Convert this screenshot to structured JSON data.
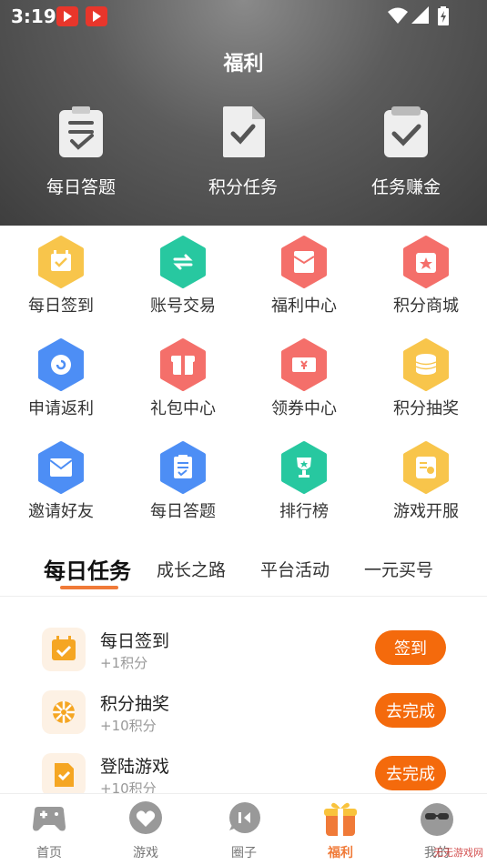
{
  "status_bar": {
    "time": "3:19"
  },
  "header": {
    "title": "福利",
    "items": [
      {
        "label": "每日答题",
        "icon": "quiz-clipboard-icon"
      },
      {
        "label": "积分任务",
        "icon": "points-task-doc-icon"
      },
      {
        "label": "任务赚金",
        "icon": "task-earn-clipboard-icon"
      }
    ]
  },
  "grid": [
    {
      "label": "每日签到",
      "icon": "calendar-checkin-icon",
      "color": "#f8c54b"
    },
    {
      "label": "账号交易",
      "icon": "exchange-icon",
      "color": "#27c8a0"
    },
    {
      "label": "福利中心",
      "icon": "envelope-icon",
      "color": "#f46f6a"
    },
    {
      "label": "积分商城",
      "icon": "store-bag-icon",
      "color": "#f46f6a"
    },
    {
      "label": "申请返利",
      "icon": "rebate-icon",
      "color": "#4d8ef5"
    },
    {
      "label": "礼包中心",
      "icon": "gift-icon",
      "color": "#f46f6a"
    },
    {
      "label": "领券中心",
      "icon": "coupon-icon",
      "color": "#f46f6a"
    },
    {
      "label": "积分抽奖",
      "icon": "coins-icon",
      "color": "#f8c54b"
    },
    {
      "label": "邀请好友",
      "icon": "invite-mail-icon",
      "color": "#4d8ef5"
    },
    {
      "label": "每日答题",
      "icon": "quiz-clipboard-icon",
      "color": "#4d8ef5"
    },
    {
      "label": "排行榜",
      "icon": "trophy-icon",
      "color": "#27c8a0"
    },
    {
      "label": "游戏开服",
      "icon": "server-open-icon",
      "color": "#f8c54b"
    }
  ],
  "tabs": [
    {
      "label": "每日任务",
      "active": true
    },
    {
      "label": "成长之路",
      "active": false
    },
    {
      "label": "平台活动",
      "active": false
    },
    {
      "label": "一元买号",
      "active": false
    }
  ],
  "tasks": [
    {
      "name": "每日签到",
      "points": "+1积分",
      "button": "签到",
      "icon": "calendar-check-icon"
    },
    {
      "name": "积分抽奖",
      "points": "+10积分",
      "button": "去完成",
      "icon": "wheel-icon"
    },
    {
      "name": "登陆游戏",
      "points": "+10积分",
      "button": "去完成",
      "icon": "login-doc-icon"
    }
  ],
  "bottom_nav": [
    {
      "label": "首页",
      "icon": "gamepad-icon",
      "active": false
    },
    {
      "label": "游戏",
      "icon": "heart-bubble-icon",
      "active": false
    },
    {
      "label": "圈子",
      "icon": "circle-chat-icon",
      "active": false
    },
    {
      "label": "福利",
      "icon": "gift-box-icon",
      "active": true
    },
    {
      "label": "我的",
      "icon": "profile-icon",
      "active": false
    }
  ],
  "watermark": "无无游戏网",
  "colors": {
    "accent": "#f46a0c",
    "tab_underline": "#f07a38",
    "header_bg": "#555555"
  }
}
